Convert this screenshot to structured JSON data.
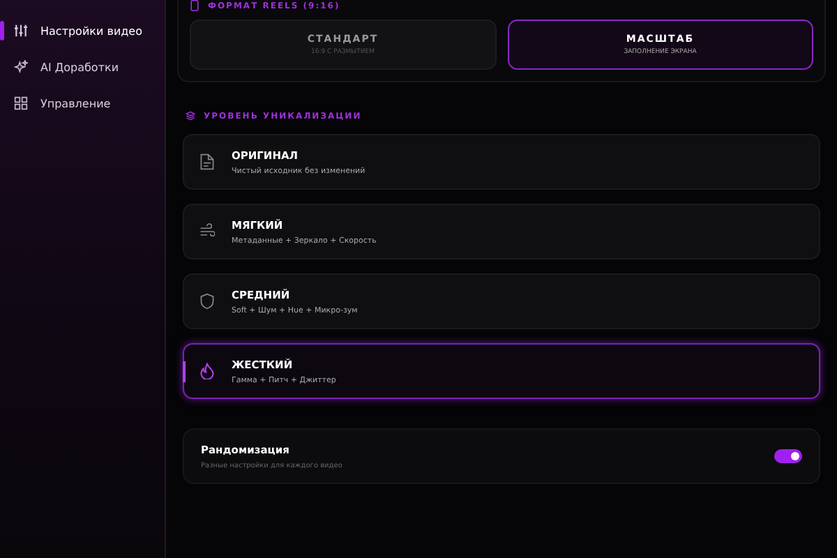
{
  "sidebar": {
    "items": [
      {
        "label": "Настройки видео",
        "kind": "sliders",
        "selected": true
      },
      {
        "label": "AI Доработки",
        "kind": "sparkle",
        "selected": false
      },
      {
        "label": "Управление",
        "kind": "grid",
        "selected": false
      }
    ]
  },
  "format": {
    "title": "ФОРМАТ REELS (9:16)",
    "options": [
      {
        "label": "СТАНДАРТ",
        "sub": "16:9 С РАЗМЫТИЕМ",
        "selected": false
      },
      {
        "label": "МАСШТАБ",
        "sub": "ЗАПОЛНЕНИЕ ЭКРАНА",
        "selected": true
      }
    ]
  },
  "levels": {
    "title": "УРОВЕНЬ УНИКАЛИЗАЦИИ",
    "items": [
      {
        "label": "ОРИГИНАЛ",
        "sub": "Чистый исходник без изменений",
        "kind": "file",
        "selected": false
      },
      {
        "label": "МЯГКИЙ",
        "sub": "Метаданные + Зеркало + Скорость",
        "kind": "wind",
        "selected": false
      },
      {
        "label": "СРЕДНИЙ",
        "sub": "Soft + Шум + Hue + Микро-зум",
        "kind": "shield",
        "selected": false
      },
      {
        "label": "ЖЕСТКИЙ",
        "sub": "Гамма + Питч + Джиттер",
        "kind": "flame",
        "selected": true
      }
    ]
  },
  "randomize": {
    "label": "Рандомизация",
    "sub": "Разные настройки для каждого видео",
    "on": true
  }
}
